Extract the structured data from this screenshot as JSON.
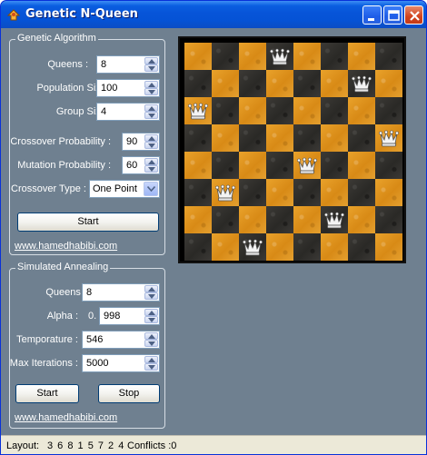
{
  "window": {
    "title": "Genetic N-Queen"
  },
  "genetic": {
    "group_title": "Genetic Algorithm",
    "queens_label": "Queens :",
    "queens_value": "8",
    "population_label": "Population Size :",
    "population_value": "100",
    "group_size_label": "Group Size :",
    "group_size_value": "4",
    "crossover_prob_label": "Crossover Probability :",
    "crossover_prob_value": "90",
    "mutation_prob_label": "Mutation Probability :",
    "mutation_prob_value": "60",
    "crossover_type_label": "Crossover Type :",
    "crossover_type_value": "One Point",
    "start_label": "Start",
    "link": "www.hamedhabibi.com"
  },
  "annealing": {
    "group_title": "Simulated Annealing",
    "queens_label": "Queens :",
    "queens_value": "8",
    "alpha_label": "Alpha :",
    "alpha_prefix": "0.",
    "alpha_value": "998",
    "temperature_label": "Temporature :",
    "temperature_value": "546",
    "max_iter_label": "Max Iterations :",
    "max_iter_value": "5000",
    "start_label": "Start",
    "stop_label": "Stop",
    "link": "www.hamedhabibi.com"
  },
  "board": {
    "size": 8,
    "queen_columns_by_row": [
      3,
      6,
      0,
      7,
      4,
      1,
      5,
      2
    ],
    "light_color": "#e29a22",
    "dark_color": "#33312e"
  },
  "status": {
    "layout_label": "Layout:",
    "layout_value": "3 6 8 1 5 7 2 4",
    "conflicts_label": "Conflicts :0"
  },
  "icons": {
    "app": "app-icon",
    "minimize": "minimize-icon",
    "maximize": "maximize-icon",
    "close": "close-icon",
    "queen": "queen-icon"
  }
}
